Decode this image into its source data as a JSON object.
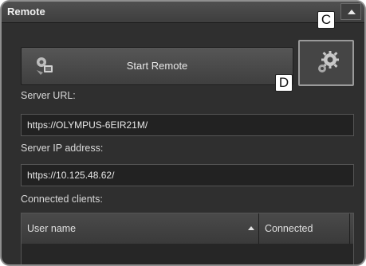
{
  "panel": {
    "title": "Remote",
    "collapse_icon": "triangle-up-icon"
  },
  "callouts": {
    "c": "C",
    "d": "D"
  },
  "start_remote": {
    "label": "Start Remote",
    "icon": "remote-connect-icon"
  },
  "settings": {
    "icon": "gear-icon"
  },
  "server_url": {
    "label": "Server URL:",
    "value": "https://OLYMPUS-6EIR21M/"
  },
  "server_ip": {
    "label": "Server IP address:",
    "value": "https://10.125.48.62/"
  },
  "clients": {
    "label": "Connected clients:",
    "columns": [
      "User name",
      "Connected"
    ]
  },
  "colors": {
    "panel_bg": "#2f2f2f",
    "titlebar": "#4a4a4a",
    "text": "#e6e6e6"
  }
}
